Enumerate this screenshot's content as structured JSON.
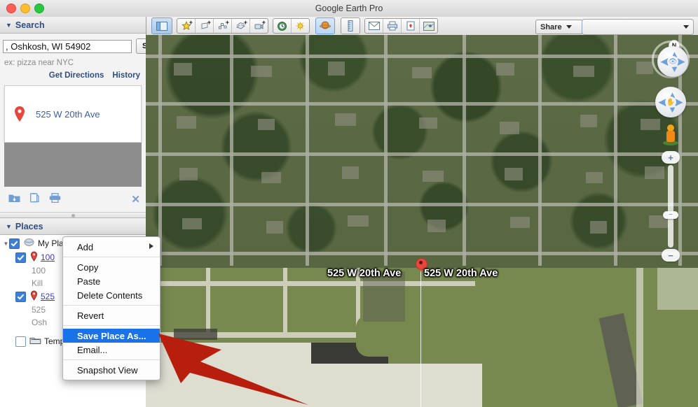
{
  "window": {
    "title": "Google Earth Pro",
    "controls": [
      "close",
      "minimize",
      "maximize"
    ]
  },
  "toolbar": {
    "sidebar_toggle_icon": "sidebar-toggle-icon",
    "groups": [
      {
        "name": "add-tools",
        "buttons": [
          {
            "icon": "add-placemark-icon",
            "badge": "+"
          },
          {
            "icon": "add-polygon-icon",
            "badge": "+"
          },
          {
            "icon": "add-path-icon",
            "badge": "+"
          },
          {
            "icon": "add-image-overlay-icon",
            "badge": "+"
          },
          {
            "icon": "record-tour-icon",
            "badge": "+"
          }
        ]
      },
      {
        "name": "time-tools",
        "buttons": [
          {
            "icon": "historical-imagery-clock-icon",
            "badge": ""
          },
          {
            "icon": "sunlight-icon",
            "badge": ""
          }
        ]
      }
    ],
    "planet_icon": "planet-globe-icon",
    "ruler_icon": "ruler-icon",
    "email_icon": "email-icon",
    "print_icon": "print-icon",
    "save_image_icon": "save-image-icon",
    "view_in_maps_icon": "view-in-google-maps-icon",
    "share_label": "Share",
    "layer_combo_value": ""
  },
  "search_panel": {
    "header": "Search",
    "input_value": ", Oshkosh, WI 54902",
    "input_placeholder": "",
    "search_button": "Search",
    "hint": "ex: pizza near NYC",
    "get_directions": "Get Directions",
    "history": "History",
    "result": {
      "pin_icon": "map-pin-icon",
      "label": "525 W 20th Ave"
    },
    "tools": [
      {
        "icon": "save-to-folder-icon"
      },
      {
        "icon": "copy-icon"
      },
      {
        "icon": "print-icon"
      }
    ],
    "close_icon": "close-icon"
  },
  "places_panel": {
    "header": "Places",
    "items": [
      {
        "label": "My Places",
        "icon": "my-places-icon",
        "checked": true,
        "expanded": true,
        "indent": 0,
        "link": false
      },
      {
        "label": "100",
        "icon": "placemark-pin-icon",
        "checked": true,
        "indent": 1,
        "link": true
      },
      {
        "label": "100",
        "icon": "",
        "indent": 2,
        "sub": true
      },
      {
        "label": "Kill",
        "icon": "",
        "indent": 2,
        "sub": true
      },
      {
        "label": "525",
        "icon": "placemark-pin-icon",
        "checked": true,
        "indent": 1,
        "link": true
      },
      {
        "label": "525",
        "icon": "",
        "indent": 2,
        "sub": true
      },
      {
        "label": "Osh",
        "icon": "",
        "indent": 2,
        "sub": true
      },
      {
        "label": "Temp",
        "icon": "temporary-places-folder-icon",
        "checked": false,
        "indent": 0,
        "link": false
      }
    ]
  },
  "context_menu": {
    "items": [
      {
        "label": "Add",
        "submenu": true,
        "selected": false
      },
      {
        "separator": true
      },
      {
        "label": "Copy",
        "selected": false
      },
      {
        "label": "Paste",
        "selected": false
      },
      {
        "label": "Delete Contents",
        "selected": false
      },
      {
        "separator": true
      },
      {
        "label": "Revert",
        "selected": false
      },
      {
        "separator": true
      },
      {
        "label": "Save Place As...",
        "selected": true
      },
      {
        "label": "Email...",
        "selected": false
      },
      {
        "separator": true
      },
      {
        "label": "Snapshot View",
        "selected": false
      }
    ],
    "highlight_color": "#1a72e8"
  },
  "map": {
    "labels": [
      {
        "text": "525 W 20th Ave",
        "position": "left-of-pin"
      },
      {
        "text": "525 W 20th Ave",
        "position": "right-of-pin"
      }
    ],
    "placemark_icon": "map-pin-icon",
    "navigation": {
      "north_label": "N",
      "look_joystick_icon": "eye-icon",
      "move_joystick_icon": "hand-icon",
      "street_view_icon": "pegman-icon",
      "zoom_in_label": "+",
      "zoom_out_label": "−",
      "zoom_thumb_label": "−"
    }
  },
  "annotation": {
    "arrow_color": "#b81e0e",
    "name": "red-pointer-arrow"
  }
}
